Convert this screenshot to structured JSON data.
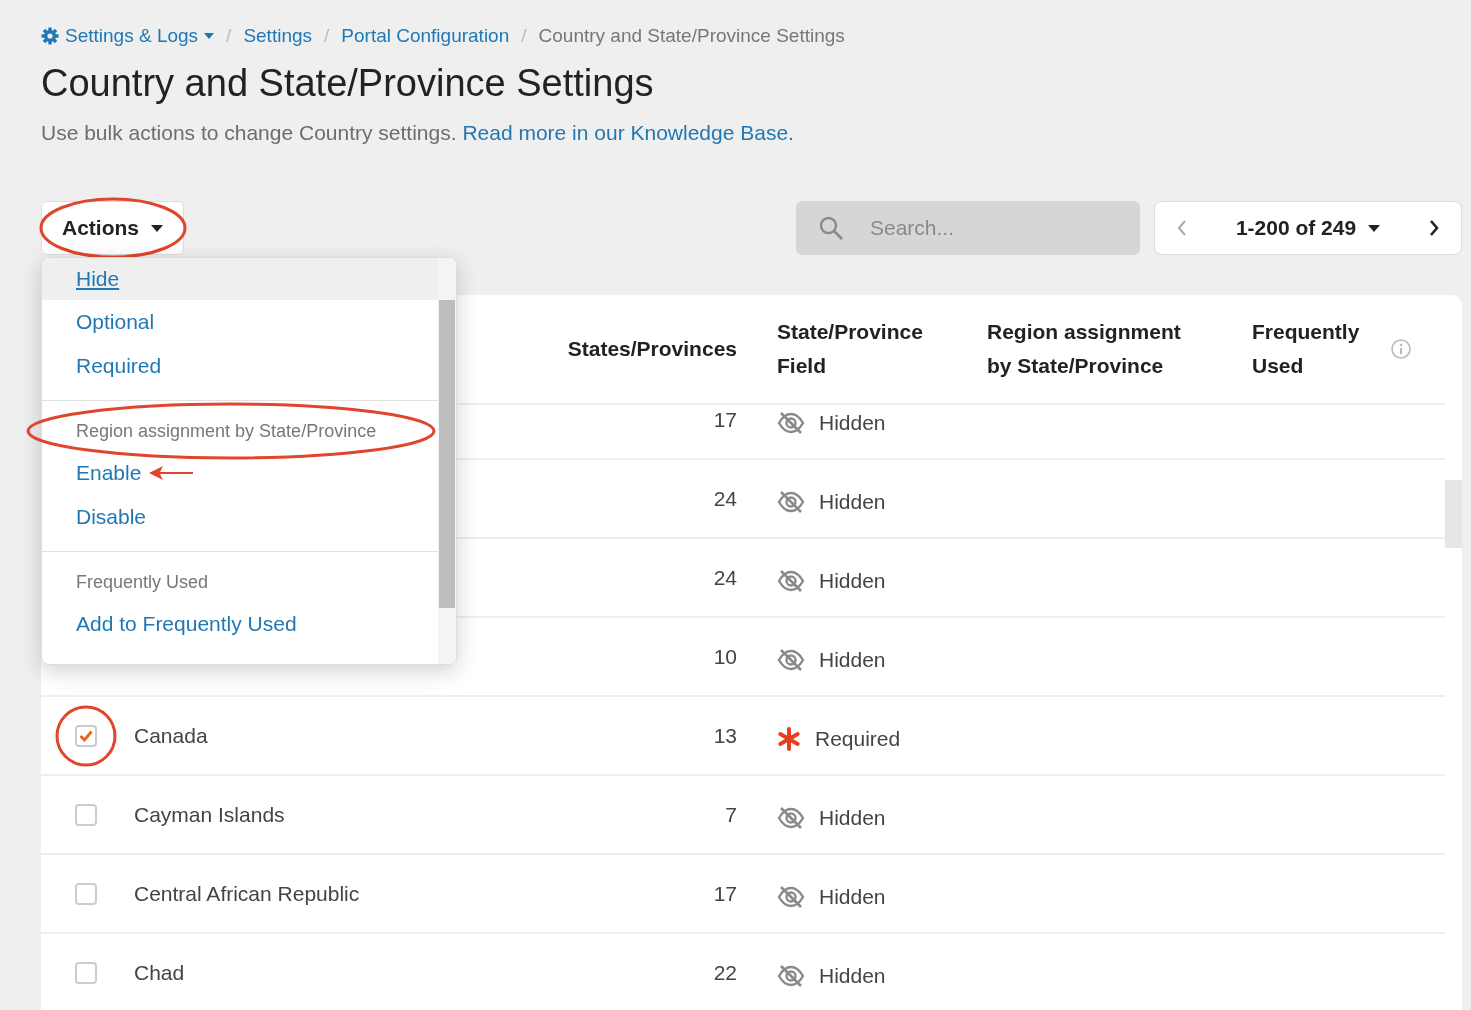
{
  "breadcrumb": [
    {
      "label": "Settings & Logs",
      "kind": "menu"
    },
    {
      "label": "Settings",
      "kind": "link",
      "separator": "/"
    },
    {
      "label": "Portal Configuration",
      "kind": "link",
      "separator": "/"
    },
    {
      "label": "Country and State/Province Settings",
      "kind": "current",
      "separator": "/"
    }
  ],
  "title": "Country and State/Province Settings",
  "description": {
    "text": "Use bulk actions to change Country settings.",
    "link": "Read more in our Knowledge Base."
  },
  "actions_button": {
    "label": "Actions",
    "annotated": true
  },
  "actions_menu": {
    "sections": [
      {
        "items": [
          {
            "label": "Hide",
            "highlighted": true
          },
          {
            "label": "Optional",
            "highlighted": false
          },
          {
            "label": "Required",
            "highlighted": false
          }
        ]
      },
      {
        "heading": "Region assignment by State/Province",
        "heading_annotated": true,
        "items": [
          {
            "label": "Enable",
            "highlighted": false,
            "arrow": true
          },
          {
            "label": "Disable",
            "highlighted": false,
            "arrow": false
          }
        ]
      },
      {
        "heading": "Frequently Used",
        "heading_annotated": false,
        "items": [
          {
            "label": "Add to Frequently Used",
            "highlighted": false
          }
        ]
      }
    ]
  },
  "search": {
    "placeholder": "Search..."
  },
  "pagination": {
    "range": "1-200 of 249"
  },
  "table": {
    "columns": [
      "States/Provinces",
      "State/Province Field",
      "Region assignment by State/Province",
      "Frequently Used"
    ],
    "rows": [
      {
        "count": "17",
        "status": {
          "kind": "hidden",
          "label": "Hidden"
        }
      },
      {
        "count": "24",
        "status": {
          "kind": "hidden",
          "label": "Hidden"
        }
      },
      {
        "count": "24",
        "status": {
          "kind": "hidden",
          "label": "Hidden"
        }
      },
      {
        "count": "10",
        "status": {
          "kind": "hidden",
          "label": "Hidden"
        }
      },
      {
        "name": "Canada",
        "checked": true,
        "annotated": true,
        "count": "13",
        "status": {
          "kind": "required",
          "label": "Required"
        }
      },
      {
        "name": "Cayman Islands",
        "checked": false,
        "annotated": false,
        "count": "7",
        "status": {
          "kind": "hidden",
          "label": "Hidden"
        }
      },
      {
        "name": "Central African Republic",
        "checked": false,
        "annotated": false,
        "count": "17",
        "status": {
          "kind": "hidden",
          "label": "Hidden"
        }
      },
      {
        "name": "Chad",
        "checked": false,
        "annotated": false,
        "count": "22",
        "status": {
          "kind": "hidden",
          "label": "Hidden"
        }
      }
    ]
  }
}
